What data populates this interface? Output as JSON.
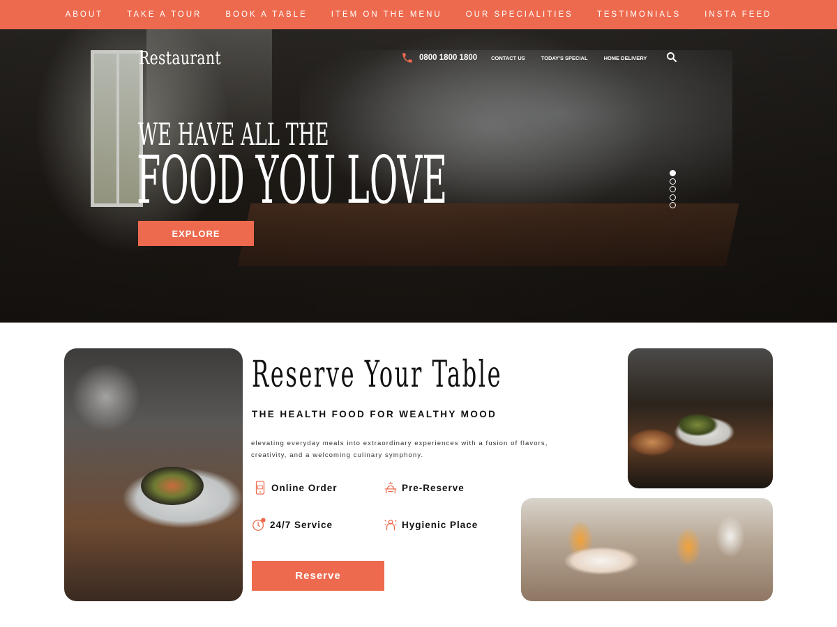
{
  "topnav": {
    "items": [
      {
        "label": "ABOUT"
      },
      {
        "label": "TAKE A TOUR"
      },
      {
        "label": "BOOK A TABLE"
      },
      {
        "label": "ITEM ON THE MENU"
      },
      {
        "label": "OUR SPECIALITIES"
      },
      {
        "label": "TESTIMONIALS"
      },
      {
        "label": "INSTA FEED"
      }
    ]
  },
  "header": {
    "brand": "Restaurant",
    "phone": "0800 1800 1800",
    "links": [
      {
        "label": "CONTACT US"
      },
      {
        "label": "TODAY'S SPECIAL"
      },
      {
        "label": "HOME DELIVERY"
      }
    ],
    "icons": {
      "phone": "phone-icon",
      "search": "search-icon"
    }
  },
  "hero": {
    "line1": "WE HAVE ALL THE",
    "line2": "FOOD YOU LOVE",
    "cta": "EXPLORE",
    "slides": {
      "count": 5,
      "active": 1
    }
  },
  "reserve": {
    "title": "Reserve Your Table",
    "subtitle": "THE HEALTH FOOD FOR WEALTHY MOOD",
    "description": "elevating everyday meals into extraordinary experiences with a fusion of flavors, creativity, and a welcoming culinary symphony.",
    "features": [
      {
        "label": "Online Order",
        "icon": "mobile-order-icon"
      },
      {
        "label": "Pre-Reserve",
        "icon": "reserve-icon"
      },
      {
        "label": "24/7 Service",
        "icon": "clock-icon"
      },
      {
        "label": "Hygienic Place",
        "icon": "hygiene-icon"
      }
    ],
    "button": "Reserve"
  },
  "colors": {
    "accent": "#ee6a4e",
    "text": "#111111"
  }
}
